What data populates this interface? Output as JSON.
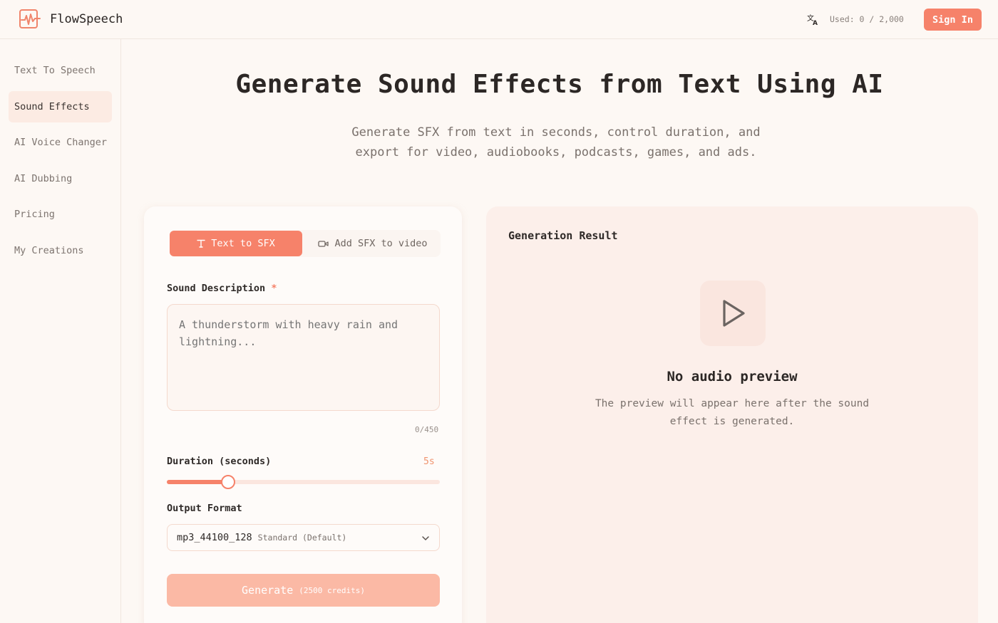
{
  "header": {
    "app_name": "FlowSpeech",
    "usage_text": "Used: 0 / 2,000",
    "sign_in_label": "Sign In"
  },
  "sidebar": {
    "items": [
      {
        "label": "Text To Speech",
        "active": false
      },
      {
        "label": "Sound Effects",
        "active": true
      },
      {
        "label": "AI Voice Changer",
        "active": false
      },
      {
        "label": "AI Dubbing",
        "active": false
      },
      {
        "label": "Pricing",
        "active": false
      },
      {
        "label": "My Creations",
        "active": false
      }
    ]
  },
  "hero": {
    "title": "Generate Sound Effects from Text Using AI",
    "subtitle_line1": "Generate SFX from text in seconds, control duration, and",
    "subtitle_line2": "export for video, audiobooks, podcasts, games, and ads."
  },
  "form": {
    "tabs": [
      {
        "label": "Text to SFX",
        "active": true
      },
      {
        "label": "Add SFX to video",
        "active": false
      }
    ],
    "description_label": "Sound Description",
    "required_mark": "*",
    "description_placeholder": "A thunderstorm with heavy rain and lightning...",
    "description_value": "",
    "char_count": "0/450",
    "duration_label": "Duration (seconds)",
    "duration_value_text": "5s",
    "duration_fraction": 0.225,
    "format_label": "Output Format",
    "format_value": "mp3_44100_128",
    "format_sub": "Standard (Default)",
    "generate_label": "Generate",
    "generate_credits": "(2500 credits)"
  },
  "result": {
    "title": "Generation Result",
    "empty_title": "No audio preview",
    "empty_desc_line1": "The preview will appear here after the sound",
    "empty_desc_line2": "effect is generated."
  },
  "colors": {
    "accent": "#f6826a",
    "accent_disabled": "#fbb9a5",
    "background": "#fdf8f4",
    "panel": "#fcefea"
  }
}
